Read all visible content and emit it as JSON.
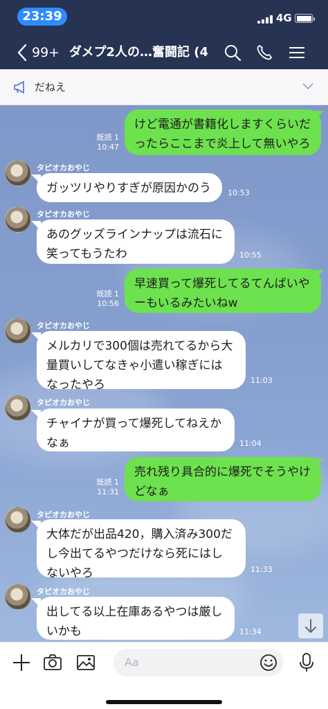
{
  "status_bar": {
    "time": "23:39",
    "network": "4G"
  },
  "header": {
    "back_count": "99+",
    "title": "ダメプ2人の…奮闘記 (4)",
    "icons": [
      "search-icon",
      "phone-icon",
      "menu-icon"
    ]
  },
  "notice": {
    "text": "だねえ"
  },
  "messages": [
    {
      "side": "me",
      "lines": "けど電通が書籍化しますくらいだ\nったらここまで炎上して無いやろ",
      "read": "既読 1",
      "time": "10:47"
    },
    {
      "side": "them",
      "sender": "タピオカおやじ",
      "lines": "ガッツリやりすぎが原因かのう",
      "time": "10:53"
    },
    {
      "side": "them",
      "sender": "タピオカおやじ",
      "lines": "あのグッズラインナップは流石に\n笑ってもうたわ",
      "time": "10:55"
    },
    {
      "side": "me",
      "lines": "早速買って爆死してるてんばいや\nーもいるみたいねw",
      "read": "既読 1",
      "time": "10:56"
    },
    {
      "side": "them",
      "sender": "タピオカおやじ",
      "lines": "メルカリで300個は売れてるから大\n量買いしてなきゃ小遣い稼ぎには\nなったやろ",
      "time": "11:03"
    },
    {
      "side": "them",
      "sender": "タピオカおやじ",
      "lines": "チャイナが買って爆死してねえか\nなぁ",
      "time": "11:04"
    },
    {
      "side": "me",
      "lines": "売れ残り具合的に爆死でそうやけ\nどなぁ",
      "read": "既読 1",
      "time": "11:31"
    },
    {
      "side": "them",
      "sender": "タピオカおやじ",
      "lines": "大体だが出品420，購入済み300だ\nし今出てるやつだけなら死にはし\nないやろ",
      "time": "11:33"
    },
    {
      "side": "them",
      "sender": "タピオカおやじ",
      "lines": "出してる以上在庫あるやつは厳し\nいかも",
      "time": "11:34"
    }
  ],
  "input": {
    "placeholder": "Aa"
  },
  "bottom_icons": [
    "plus-icon",
    "camera-icon",
    "image-icon",
    "emoji-icon",
    "mic-icon"
  ]
}
